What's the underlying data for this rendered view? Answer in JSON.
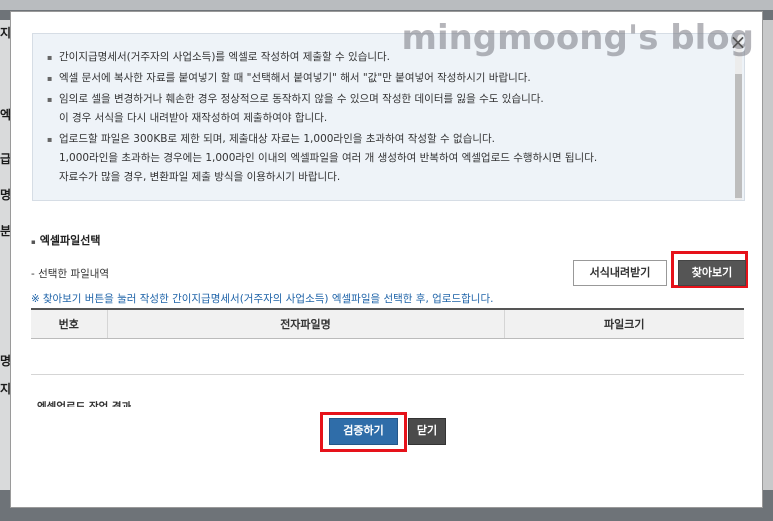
{
  "watermark": "mingmoong's blog",
  "background": {
    "left_chars": [
      "지",
      "엑",
      "급",
      "명",
      "분",
      "명",
      "지"
    ]
  },
  "modal": {
    "close_symbol": "×",
    "notice_items": [
      "간이지급명세서(거주자의 사업소득)를 엑셀로 작성하여 제출할 수 있습니다.",
      "엑셀 문서에 복사한 자료를 붙여넣기 할 때 \"선택해서 붙여넣기\" 해서 \"값\"만 붙여넣어 작성하시기 바랍니다.",
      "임의로 셀을 변경하거나 훼손한 경우 정상적으로 동작하지 않을 수 있으며 작성한 데이터를 잃을 수도 있습니다.",
      "이 경우 서식을 다시 내려받아 재작성하여 제출하여야 합니다.",
      "업로드할 파일은 300KB로 제한 되며, 제출대상 자료는 1,000라인을 초과하여 작성할 수 없습니다.",
      "1,000라인을 초과하는 경우에는 1,000라인 이내의 엑셀파일을 여러 개 생성하여 반복하여 엑셀업로드 수행하시면 됩니다.",
      "자료수가 많을 경우, 변환파일 제출 방식을 이용하시기 바랍니다."
    ],
    "section_title": "엑셀파일선택",
    "selected_label": "- 선택한 파일내역",
    "template_button": "서식내려받기",
    "find_button": "찾아보기",
    "info_mark": "※",
    "info_text": "찾아보기 버튼을 눌러 작성한 간이지급명세서(거주자의 사업소득) 엑셀파일을 선택한 후, 업로드합니다.",
    "table_headers": [
      "번호",
      "전자파일명",
      "파일크기"
    ],
    "cut_off_text": "엑셀업로드 작업 결과",
    "verify_button": "검증하기",
    "close_button": "닫기"
  }
}
